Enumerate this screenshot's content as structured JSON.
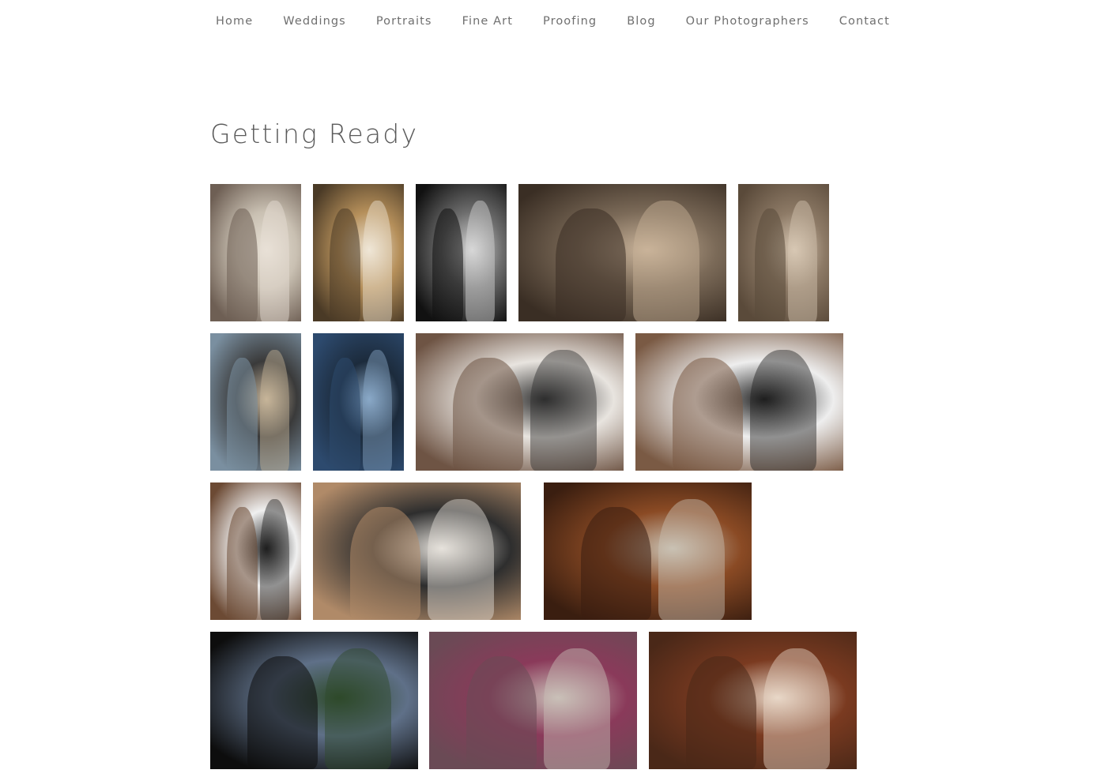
{
  "nav": {
    "items": [
      {
        "label": "Home",
        "key": "home"
      },
      {
        "label": "Weddings",
        "key": "weddings"
      },
      {
        "label": "Portraits",
        "key": "portraits"
      },
      {
        "label": "Fine Art",
        "key": "fine-art"
      },
      {
        "label": "Proofing",
        "key": "proofing"
      },
      {
        "label": "Blog",
        "key": "blog"
      },
      {
        "label": "Our Photographers",
        "key": "our-photographers"
      },
      {
        "label": "Contact",
        "key": "contact"
      }
    ]
  },
  "gallery": {
    "title": "Getting Ready",
    "photos": [
      {
        "subject": "bride-in-window",
        "colors": [
          "#6e5f54",
          "#c9c0b2",
          "#e8e1d6"
        ]
      },
      {
        "subject": "bridesmaid-and-bride",
        "colors": [
          "#4a3a26",
          "#b58f5a",
          "#efe6d6"
        ]
      },
      {
        "subject": "bride-veil-bw",
        "colors": [
          "#111111",
          "#6d6d6d",
          "#d8d8d8"
        ]
      },
      {
        "subject": "grandmother-laughing-groom",
        "colors": [
          "#3a2e24",
          "#7b6a58",
          "#c9b39a"
        ]
      },
      {
        "subject": "groom-with-guests",
        "colors": [
          "#5a4a3a",
          "#8d7a66",
          "#d8c8b4"
        ]
      },
      {
        "subject": "boutonniere-outdoor",
        "colors": [
          "#7a8fa0",
          "#3a3a3a",
          "#c7b59a"
        ]
      },
      {
        "subject": "boutonniere-outdoor-blue",
        "colors": [
          "#2d4a6e",
          "#1c2b3c",
          "#8aa9c8"
        ]
      },
      {
        "subject": "father-fixing-collar",
        "colors": [
          "#6e5444",
          "#e8e4df",
          "#2e2e2e"
        ]
      },
      {
        "subject": "cufflinks-teal-tie",
        "colors": [
          "#7a5a44",
          "#eeeeee",
          "#1e1e1e"
        ]
      },
      {
        "subject": "cufflinks-closeup",
        "colors": [
          "#6c4a34",
          "#f0f0f0",
          "#1e1e1e"
        ]
      },
      {
        "subject": "groomsmen-laughing",
        "colors": [
          "#b08a68",
          "#2e2e2e",
          "#e6e2dc"
        ]
      },
      {
        "subject": "suit-hanging-hallway",
        "colors": [
          "#3a1e10",
          "#8a4a24",
          "#c9c2b4"
        ]
      },
      {
        "subject": "mountain-view-window",
        "colors": [
          "#0d0d0d",
          "#5f7088",
          "#2e4a2a"
        ]
      },
      {
        "subject": "purple-vest-buttons",
        "colors": [
          "#6a4a55",
          "#8a3a5a",
          "#c9c0b8"
        ]
      },
      {
        "subject": "groom-tie-bar",
        "colors": [
          "#4a2818",
          "#7a3a20",
          "#e8d8c8"
        ]
      }
    ]
  }
}
